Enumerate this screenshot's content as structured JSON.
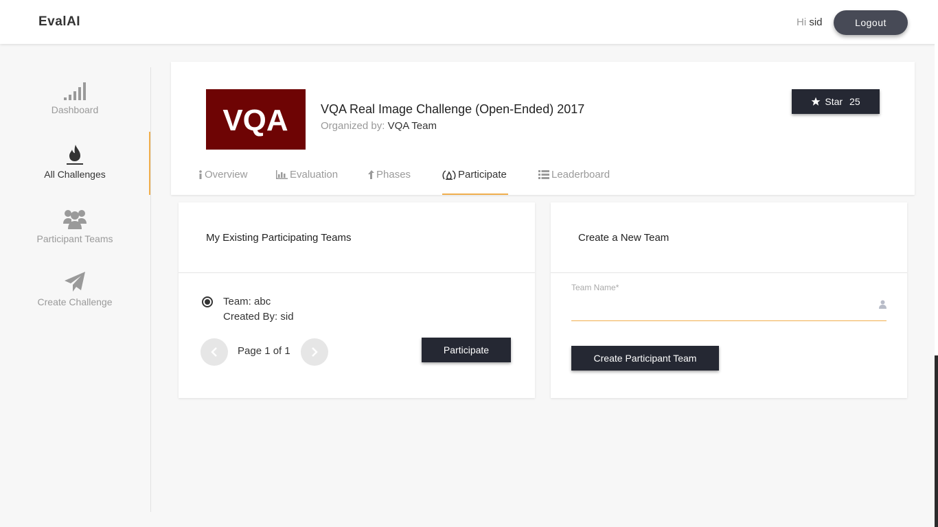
{
  "header": {
    "logo": "EvalAI",
    "greeting_prefix": "Hi",
    "username": "sid",
    "logout_label": "Logout"
  },
  "sidebar": {
    "items": [
      {
        "label": "Dashboard",
        "icon": "signal-bars-icon"
      },
      {
        "label": "All Challenges",
        "icon": "flame-icon",
        "active": true
      },
      {
        "label": "Participant Teams",
        "icon": "users-icon"
      },
      {
        "label": "Create Challenge",
        "icon": "paper-plane-icon"
      }
    ]
  },
  "challenge": {
    "logo_text": "VQA",
    "title": "VQA Real Image Challenge (Open-Ended) 2017",
    "organized_by_label": "Organized by:",
    "organizer": "VQA Team",
    "star_label": "Star",
    "star_count": "25"
  },
  "tabs": [
    {
      "label": "Overview",
      "icon": "info-icon"
    },
    {
      "label": "Evaluation",
      "icon": "bar-chart-icon"
    },
    {
      "label": "Phases",
      "icon": "arrow-up-icon"
    },
    {
      "label": "Participate",
      "icon": "flame-badge-icon",
      "active": true
    },
    {
      "label": "Leaderboard",
      "icon": "list-icon"
    }
  ],
  "existing_teams": {
    "title": "My Existing Participating Teams",
    "team": "Team: abc",
    "created_by": "Created By: sid",
    "pager": "Page 1 of 1",
    "participate_label": "Participate"
  },
  "new_team": {
    "title": "Create a New Team",
    "field_label": "Team Name*",
    "field_value": "",
    "create_label": "Create Participant Team"
  },
  "colors": {
    "accent": "#f0ae4c",
    "dark_button": "#252833",
    "logout_button": "#474a56",
    "vqa_logo_bg": "#6e0404"
  }
}
